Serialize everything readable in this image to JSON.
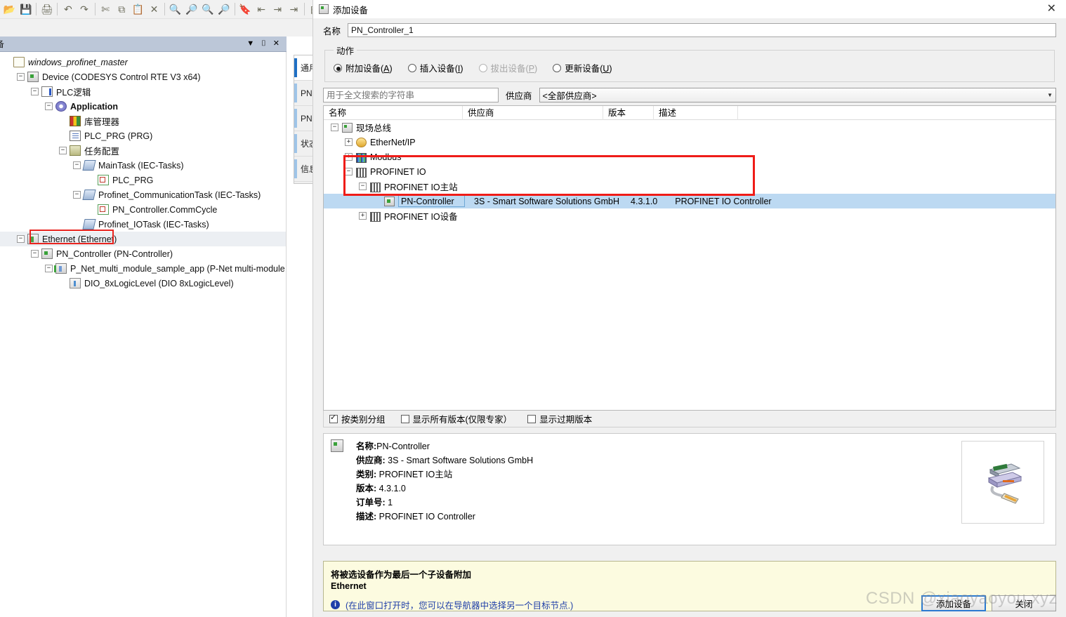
{
  "ide": {
    "toolbar_icons": [
      "open-folder-icon",
      "save-icon",
      "print-icon",
      "undo-icon",
      "redo-icon",
      "cut-icon",
      "copy-icon",
      "paste-icon",
      "delete-icon",
      "find-icon",
      "find-next-icon",
      "find-in-files-icon",
      "replace-in-files-icon",
      "bookmark-icon",
      "bookmark-prev-icon",
      "bookmark-next-icon",
      "bookmark-clear-icon",
      "build-icon"
    ],
    "panel": {
      "title": "备",
      "menu_glyph": "▼",
      "pin_glyph": "⊞",
      "close_glyph": "✕",
      "scroll_up_glyph": "▼"
    },
    "tree": [
      {
        "label": "windows_profinet_master",
        "icon": "project-icon",
        "indent": 0,
        "expander": "",
        "style": "italic"
      },
      {
        "label": "Device (CODESYS Control RTE V3 x64)",
        "icon": "device-icon",
        "indent": 1,
        "expander": "−",
        "style": ""
      },
      {
        "label": "PLC逻辑",
        "icon": "plc-logic-icon",
        "indent": 2,
        "expander": "−",
        "style": ""
      },
      {
        "label": "Application",
        "icon": "application-icon",
        "indent": 3,
        "expander": "−",
        "style": "bold"
      },
      {
        "label": "库管理器",
        "icon": "library-manager-icon",
        "indent": 4,
        "expander": "",
        "style": ""
      },
      {
        "label": "PLC_PRG (PRG)",
        "icon": "program-icon",
        "indent": 4,
        "expander": "",
        "style": ""
      },
      {
        "label": "任务配置",
        "icon": "task-configuration-icon",
        "indent": 4,
        "expander": "−",
        "style": ""
      },
      {
        "label": "MainTask (IEC-Tasks)",
        "icon": "task-icon",
        "indent": 5,
        "expander": "−",
        "style": ""
      },
      {
        "label": "PLC_PRG",
        "icon": "pou-call-icon",
        "indent": 6,
        "expander": "",
        "style": ""
      },
      {
        "label": "Profinet_CommunicationTask (IEC-Tasks)",
        "icon": "task-icon",
        "indent": 5,
        "expander": "−",
        "style": ""
      },
      {
        "label": "PN_Controller.CommCycle",
        "icon": "pou-call-icon",
        "indent": 6,
        "expander": "",
        "style": ""
      },
      {
        "label": "Profinet_IOTask (IEC-Tasks)",
        "icon": "task-icon",
        "indent": 5,
        "expander": "",
        "style": ""
      },
      {
        "label": "Ethernet (Ethernet)",
        "icon": "ethernet-icon",
        "indent": 1,
        "expander": "−",
        "style": "highlight"
      },
      {
        "label": "PN_Controller (PN-Controller)",
        "icon": "device-icon",
        "indent": 2,
        "expander": "−",
        "style": ""
      },
      {
        "label": "P_Net_multi_module_sample_app (P-Net multi-module sample ap",
        "icon": "module-icon",
        "indent": 3,
        "expander": "−",
        "style": ""
      },
      {
        "label": "DIO_8xLogicLevel (DIO 8xLogicLevel)",
        "icon": "dio-icon",
        "indent": 4,
        "expander": "",
        "style": ""
      }
    ],
    "editor_tabs": [
      {
        "label": "通用",
        "active": true
      },
      {
        "label": "PNI",
        "active": false
      },
      {
        "label": "PNI",
        "active": false
      },
      {
        "label": "状态",
        "active": false
      },
      {
        "label": "信息",
        "active": false
      }
    ]
  },
  "dialog": {
    "title": "添加设备",
    "title_icon": "device-icon",
    "close_glyph": "✕",
    "name_label": "名称",
    "name_value": "PN_Controller_1",
    "action_legend": "动作",
    "actions": [
      {
        "label": "附加设备",
        "accel": "A",
        "checked": true,
        "disabled": false
      },
      {
        "label": "插入设备",
        "accel": "I",
        "checked": false,
        "disabled": false
      },
      {
        "label": "拔出设备",
        "accel": "P",
        "checked": false,
        "disabled": true
      },
      {
        "label": "更新设备",
        "accel": "U",
        "checked": false,
        "disabled": false
      }
    ],
    "search_placeholder": "用于全文搜索的字符串",
    "vendor_label": "供应商",
    "vendor_value": "<全部供应商>",
    "vendor_chevron": "▼",
    "columns": [
      "名称",
      "供应商",
      "版本",
      "描述"
    ],
    "rows": [
      {
        "label": "现场总线",
        "icon": "fieldbus-icon",
        "indent": 0,
        "expander": "−",
        "vendor": "",
        "version": "",
        "desc": "",
        "selected": false
      },
      {
        "label": "EtherNet/IP",
        "icon": "ethernetip-icon",
        "indent": 1,
        "expander": "+",
        "vendor": "",
        "version": "",
        "desc": "",
        "selected": false
      },
      {
        "label": "Modbus",
        "icon": "modbus-icon",
        "indent": 1,
        "expander": "+",
        "vendor": "",
        "version": "",
        "desc": "",
        "selected": false
      },
      {
        "label": "PROFINET IO",
        "icon": "profinet-icon",
        "indent": 1,
        "expander": "−",
        "vendor": "",
        "version": "",
        "desc": "",
        "selected": false
      },
      {
        "label": "PROFINET IO主站",
        "icon": "profinet-icon",
        "indent": 2,
        "expander": "−",
        "vendor": "",
        "version": "",
        "desc": "",
        "selected": false
      },
      {
        "label": "PN-Controller",
        "icon": "device-icon",
        "indent": 3,
        "expander": "",
        "vendor": "3S - Smart Software Solutions GmbH",
        "version": "4.3.1.0",
        "desc": "PROFINET IO Controller",
        "selected": true
      },
      {
        "label": "PROFINET IO设备",
        "icon": "profinet-icon",
        "indent": 2,
        "expander": "+",
        "vendor": "",
        "version": "",
        "desc": "",
        "selected": false
      }
    ],
    "options": [
      {
        "label": "按类别分组",
        "checked": true
      },
      {
        "label": "显示所有版本(仅限专家）",
        "checked": false
      },
      {
        "label": "显示过期版本",
        "checked": false
      }
    ],
    "info": {
      "icon": "device-icon",
      "thumb_icon": "network-adapter-image",
      "lines": [
        {
          "key": "名称:",
          "value": "PN-Controller"
        },
        {
          "key": "供应商:",
          "value": " 3S - Smart Software Solutions GmbH"
        },
        {
          "key": "类别:",
          "value": " PROFINET IO主站"
        },
        {
          "key": "版本:",
          "value": " 4.3.1.0"
        },
        {
          "key": "订单号:",
          "value": " 1"
        },
        {
          "key": "描述:",
          "value": " PROFINET IO Controller"
        }
      ]
    },
    "message": {
      "title": "将被选设备作为最后一个子设备附加",
      "target": "Ethernet",
      "note_icon": "info-icon",
      "note": "(在此窗口打开时，您可以在导航器中选择另一个目标节点.)"
    },
    "buttons": [
      {
        "label": "添加设备",
        "primary": true
      },
      {
        "label": "关闭",
        "primary": false
      }
    ]
  },
  "watermark": "CSDN @xiaoyaoyou.xyz",
  "colors": {
    "highlight_red": "#ef1c18",
    "selection_blue": "#bcd9f2",
    "panel_header": "#bcc7d8",
    "message_bg": "#fcfbe0",
    "note_blue": "#1f3fa8",
    "primary_border": "#2b7ad1"
  }
}
